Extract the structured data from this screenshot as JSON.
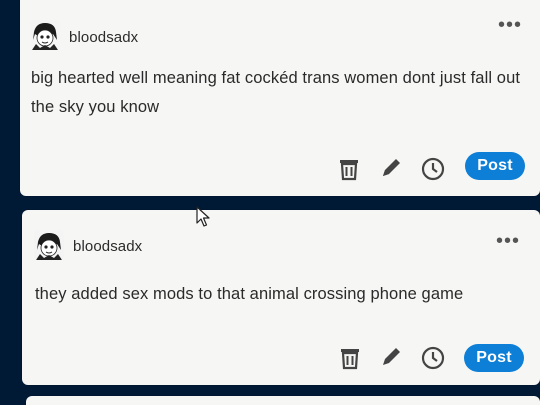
{
  "colors": {
    "dashboard_bg": "#001935",
    "card_bg": "#f6f6f4",
    "post_button": "#0e7fd6",
    "icon_color": "#555555"
  },
  "posts": [
    {
      "username": "bloodsadx",
      "more_label": "•••",
      "body_line1": "big hearted well meaning fat cockéd trans women dont just fall out",
      "body_line2": "the sky you know",
      "icons": [
        "trash-icon",
        "edit-pencil-icon",
        "queue-clock-icon"
      ],
      "post_label": "Post"
    },
    {
      "username": "bloodsadx",
      "more_label": "•••",
      "body_line1": "they added sex mods to that animal crossing phone game",
      "icons": [
        "trash-icon",
        "edit-pencil-icon",
        "queue-clock-icon"
      ],
      "post_label": "Post"
    }
  ]
}
